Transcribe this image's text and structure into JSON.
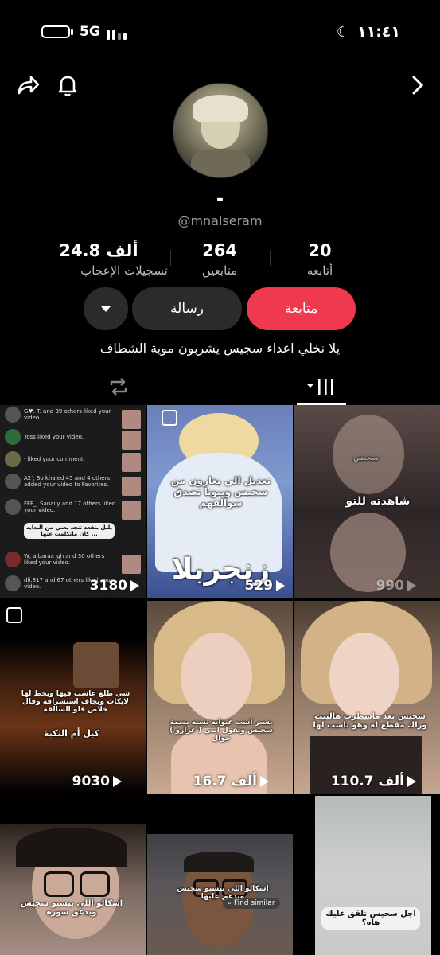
{
  "status_bar": {
    "network": "5G",
    "time": "١١:٤١"
  },
  "profile": {
    "display_name": "-",
    "username": "@mnalseram",
    "bio": "يلا نخلي اعداء سجيس يشربون موية الشطاف"
  },
  "stats": [
    {
      "value": "20",
      "label": "أتابعه"
    },
    {
      "value": "264",
      "label": "متابعين"
    },
    {
      "value": "24.8 ألف",
      "label": "تسجيلات الإعجاب"
    }
  ],
  "buttons": {
    "follow": "متابعة",
    "message": "رسالة"
  },
  "videos": [
    {
      "views": "3180",
      "caption": "يليل بتقعد تنجد يعني من البدايه كان ماتكلمت عنها ...",
      "notifications": [
        "G♥. T. and 39 others liked your video.",
        "Yoss liked your video.",
        "- liked your comment.",
        "A2', Bo khaled 45 and 4 others added your video to Favorites.",
        "FFF_. Sanaily and 17 others liked your video.",
        "W, albaraa_gh and 30 others liked your video.",
        "dli.817 and 67 others liked your video."
      ]
    },
    {
      "views": "529",
      "caption": "تعديل الي يغارون من سجيس ويبونا تصدق سوالفهم",
      "overlay": "زنجربلا"
    },
    {
      "views": "990",
      "caption": "شاهدته للتو",
      "caption2": "سجيس"
    },
    {
      "views": "9030",
      "caption": "شي طلع عاشب فيها ويحط لها لايكات ويجاف استشراقه وقال خلاص فلو السالفه",
      "caption2": "كيل أم النكبة"
    },
    {
      "views": "16.7 ألف",
      "caption": "يشبر اشب عنوابه تشبه بسمة سجيس وبقول انتي ( غزارو ) جوال"
    },
    {
      "views": "110.7 ألف",
      "caption": "سجيس نعد ماسطرت هالبنت وزاك مقطع له وهو تاشب لها"
    },
    {
      "caption": "اشكالو اللي بيسبو سجيس ويدعق سوره"
    },
    {
      "caption": "اشكالو اللي بيسبو سجيس ويدعق عليها",
      "find_similar": "Find similar"
    },
    {
      "caption": "اجل سجيس تلقق عليك هاه؟"
    }
  ]
}
